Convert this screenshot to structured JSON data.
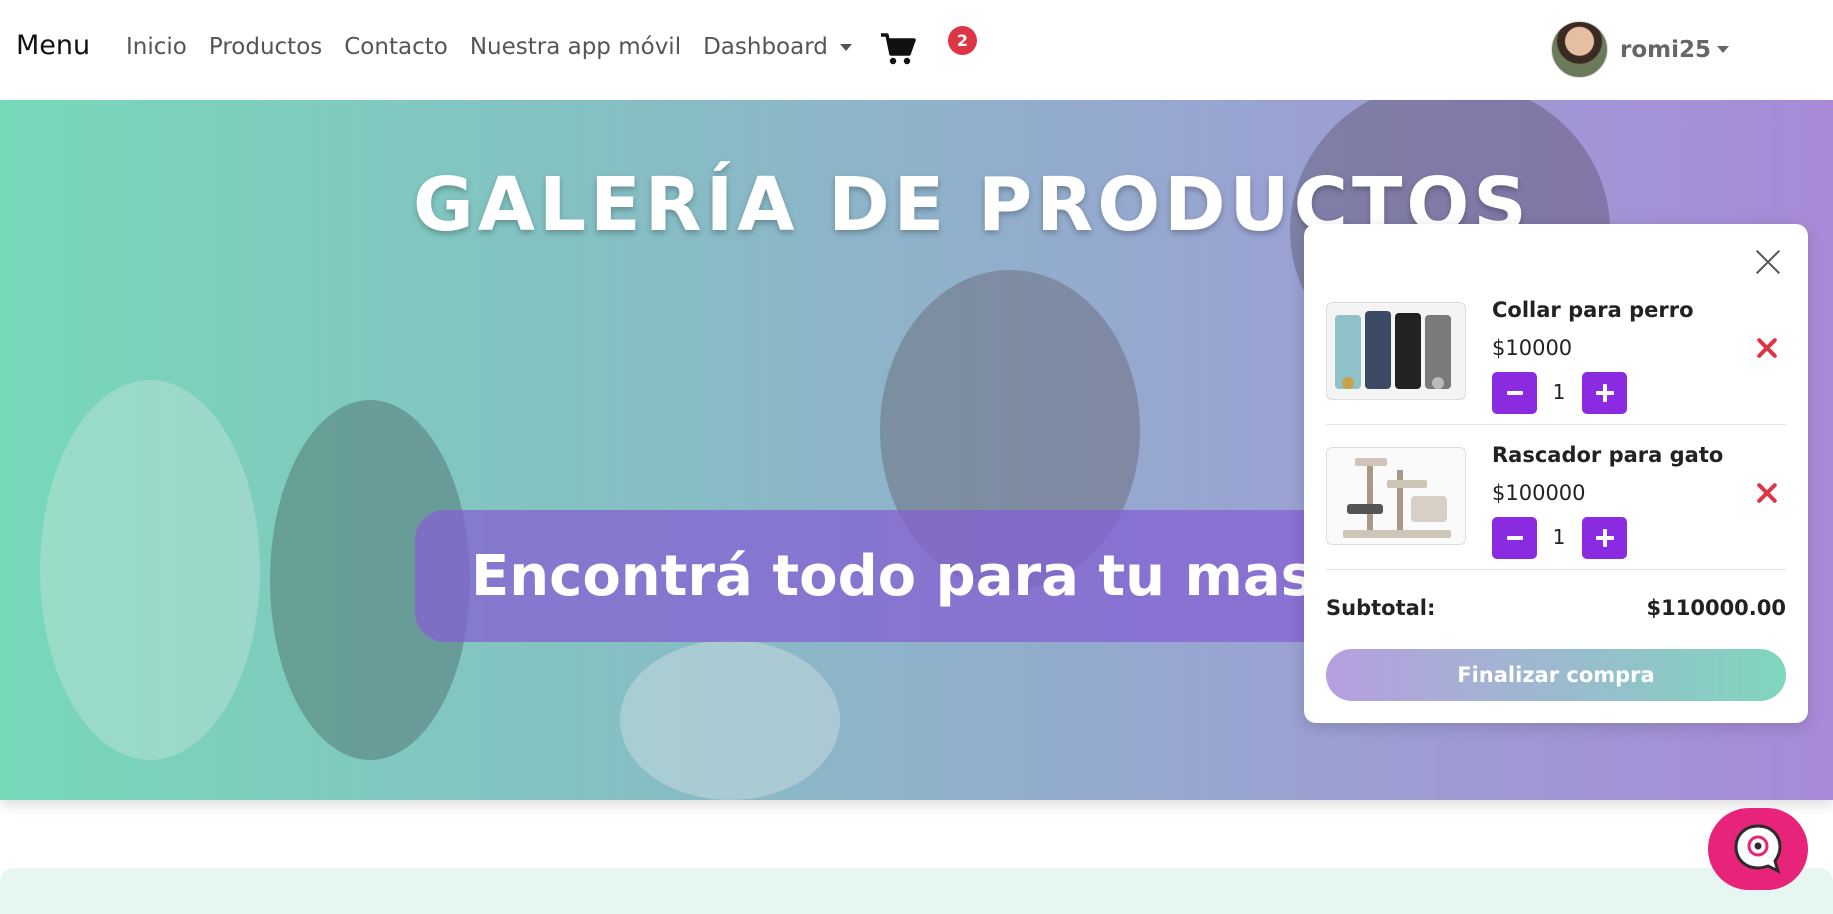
{
  "navbar": {
    "brand": "Menu",
    "links": [
      "Inicio",
      "Productos",
      "Contacto",
      "Nuestra app móvil"
    ],
    "dashboard": "Dashboard",
    "cart_count": "2",
    "username": "romi25"
  },
  "hero": {
    "title": "GALERÍA DE PRODUCTOS",
    "subtitle": "Encontrá todo para tu masco"
  },
  "cart": {
    "items": [
      {
        "name": "Collar para perro",
        "price": "$10000",
        "qty": "1"
      },
      {
        "name": "Rascador para gato",
        "price": "$100000",
        "qty": "1"
      }
    ],
    "subtotal_label": "Subtotal:",
    "subtotal_value": "$110000.00",
    "checkout_label": "Finalizar compra"
  },
  "icons": {
    "cart": "shopping-cart-icon",
    "close": "close-icon",
    "remove": "remove-icon",
    "minus": "minus-icon",
    "plus": "plus-icon",
    "chat": "chat-icon"
  },
  "colors": {
    "accent": "#8a2be2",
    "danger": "#dc3545",
    "chat": "#e8237a"
  }
}
